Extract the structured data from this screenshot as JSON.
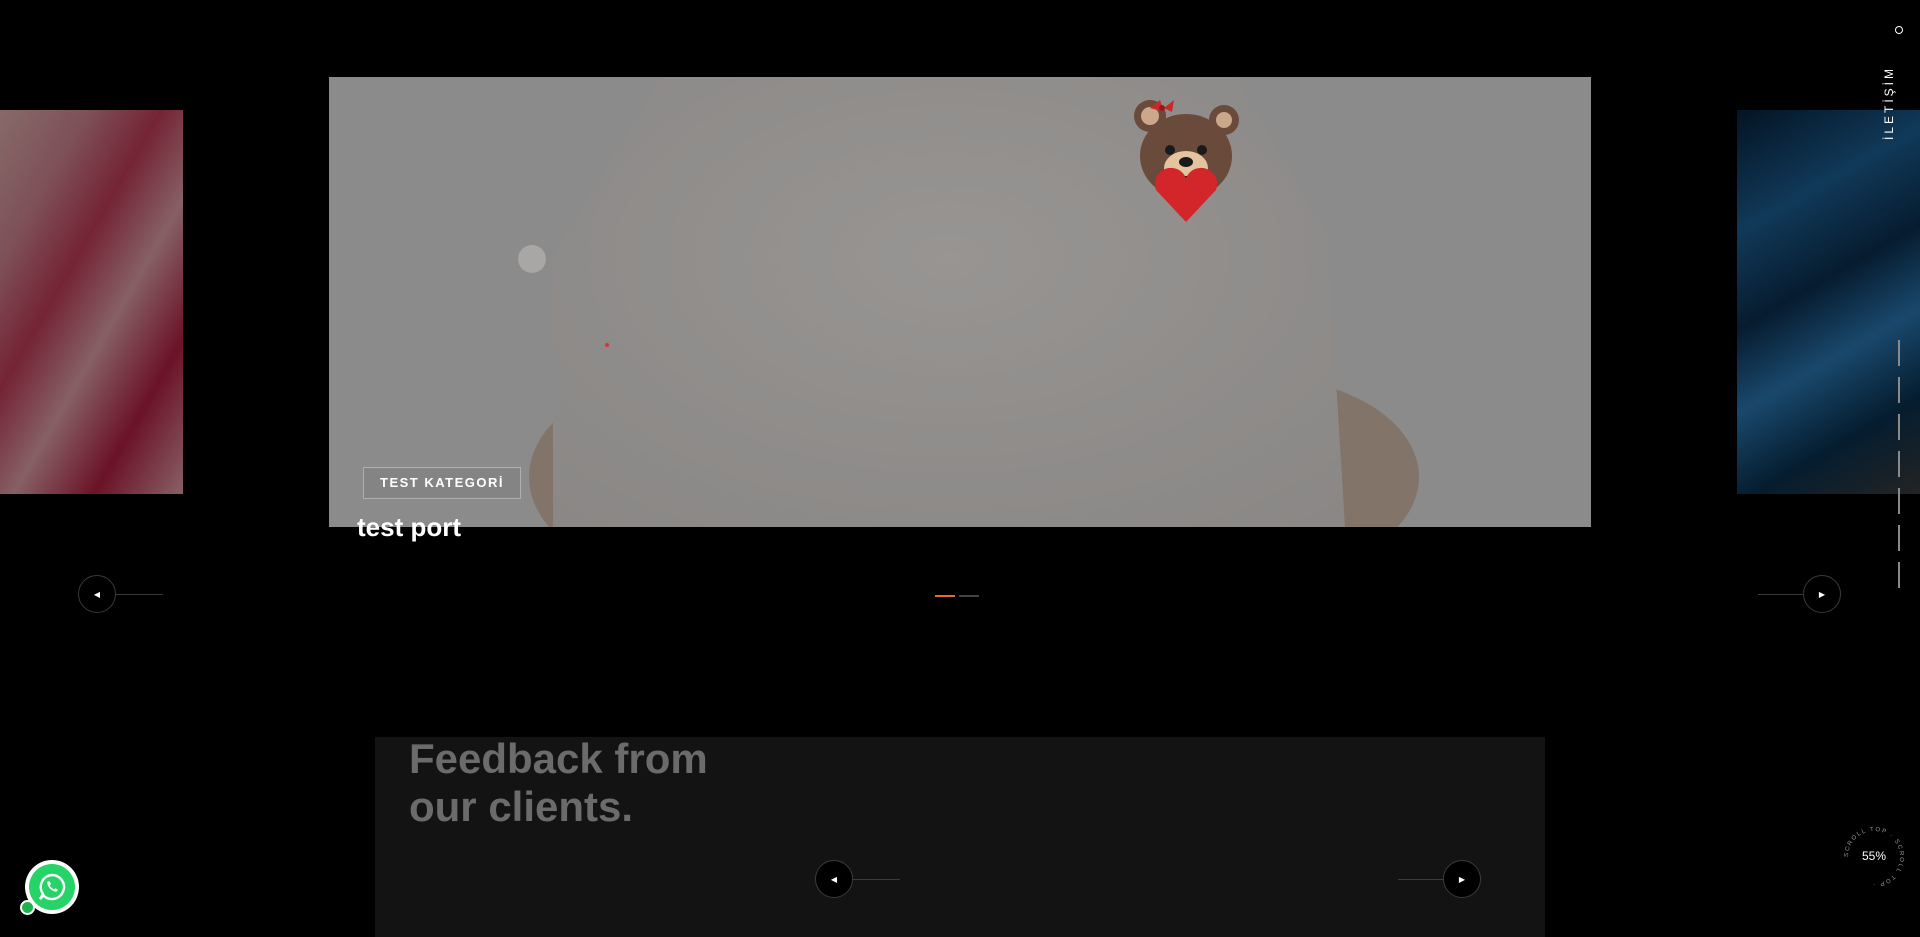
{
  "slider": {
    "category": "TEST KATEGORİ",
    "title": "test port",
    "prev_icon": "triangle-left-icon",
    "next_icon": "triangle-right-icon",
    "prev_glyph": "◀",
    "next_glyph": "▶",
    "active_slide": 1,
    "total_slides": 2,
    "accent_color": "#e56a2c"
  },
  "contact": {
    "label": "İLETİŞİM"
  },
  "testimonials": {
    "title_line1": "Feedback from",
    "title_line2": "our clients.",
    "prev_glyph": "◀",
    "next_glyph": "▶"
  },
  "whatsapp": {
    "icon": "whatsapp-icon",
    "color": "#25d366"
  },
  "scroll_top": {
    "ring_text": "SCROLL TOP · SCROLL TOP ·",
    "percent": "55%"
  }
}
